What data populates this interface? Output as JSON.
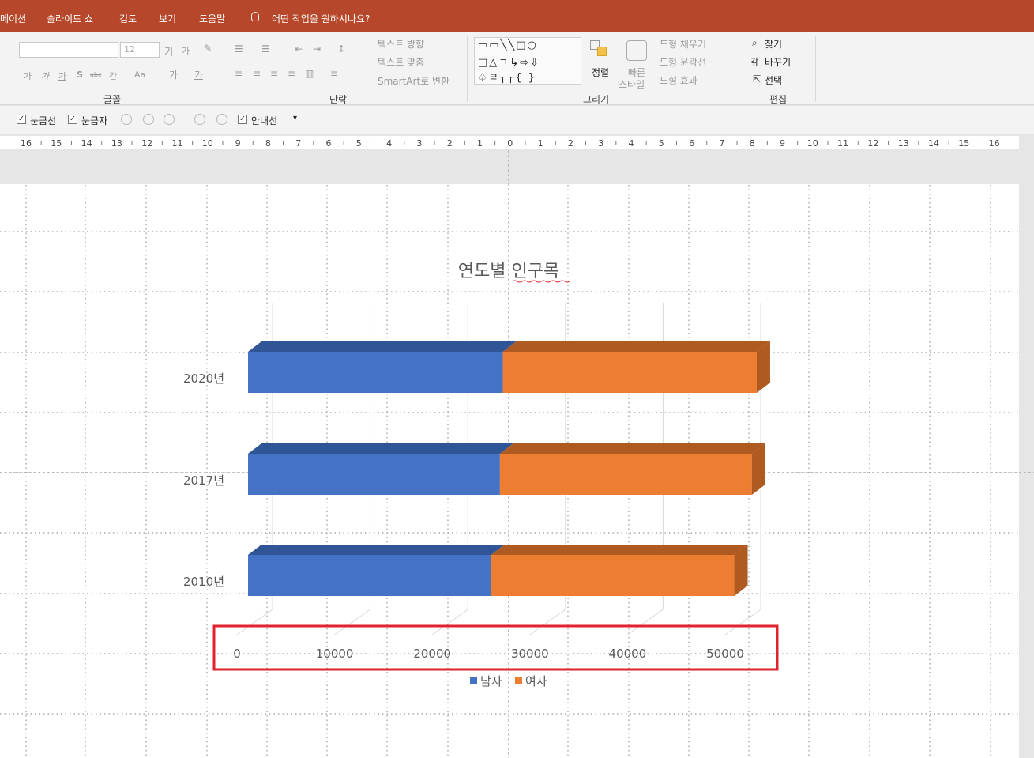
{
  "tabs": [
    "메이션",
    "슬라이드 쇼",
    "검토",
    "보기",
    "도움말"
  ],
  "tell_me": "어떤 작업을 원하시나요?",
  "ribbon": {
    "font_size": "12",
    "font_group": "글꼴",
    "paragraph_group": "단락",
    "drawing_group": "그리기",
    "editing_group": "편집",
    "text_direction": "텍스트 방향",
    "align_text": "텍스트 맞춤",
    "smartart": "SmartArt로 변환",
    "arrange": "정렬",
    "quick_styles_1": "빠른",
    "quick_styles_2": "스타일",
    "shape_fill": "도형 채우기",
    "shape_outline": "도형 윤곽선",
    "shape_effects": "도형 효과",
    "find": "찾기",
    "replace": "바꾸기",
    "select": "선택",
    "font_btns": [
      "가",
      "가",
      "가",
      "S",
      "abc",
      "간",
      "Aa"
    ]
  },
  "quickbar": {
    "gridlines": "눈금선",
    "ruler": "눈금자",
    "guides": "안내선"
  },
  "ruler_ticks": [
    "16",
    "15",
    "14",
    "13",
    "12",
    "11",
    "10",
    "9",
    "8",
    "7",
    "6",
    "5",
    "4",
    "3",
    "2",
    "1",
    "0",
    "1",
    "2",
    "3",
    "4",
    "5",
    "6",
    "7",
    "8",
    "9",
    "10",
    "11",
    "12",
    "13",
    "14",
    "15",
    "16"
  ],
  "colors": {
    "tabbar": "#b7472a",
    "male": "#4472c4",
    "male_dark": "#2f5597",
    "female": "#ed7d31",
    "female_dark": "#ae5a21",
    "highlight": "#e0232d"
  },
  "chart_data": {
    "type": "bar",
    "title": "연도별 인구목",
    "categories": [
      "2020년",
      "2017년",
      "2010년"
    ],
    "series": [
      {
        "name": "남자",
        "values": [
          26100,
          25800,
          24900
        ]
      },
      {
        "name": "여자",
        "values": [
          26000,
          25800,
          24900
        ]
      }
    ],
    "xlim": [
      0,
      50000
    ],
    "xticks": [
      0,
      10000,
      20000,
      30000,
      40000,
      50000
    ],
    "stacked": true,
    "three_d": true,
    "legend": "bottom"
  }
}
